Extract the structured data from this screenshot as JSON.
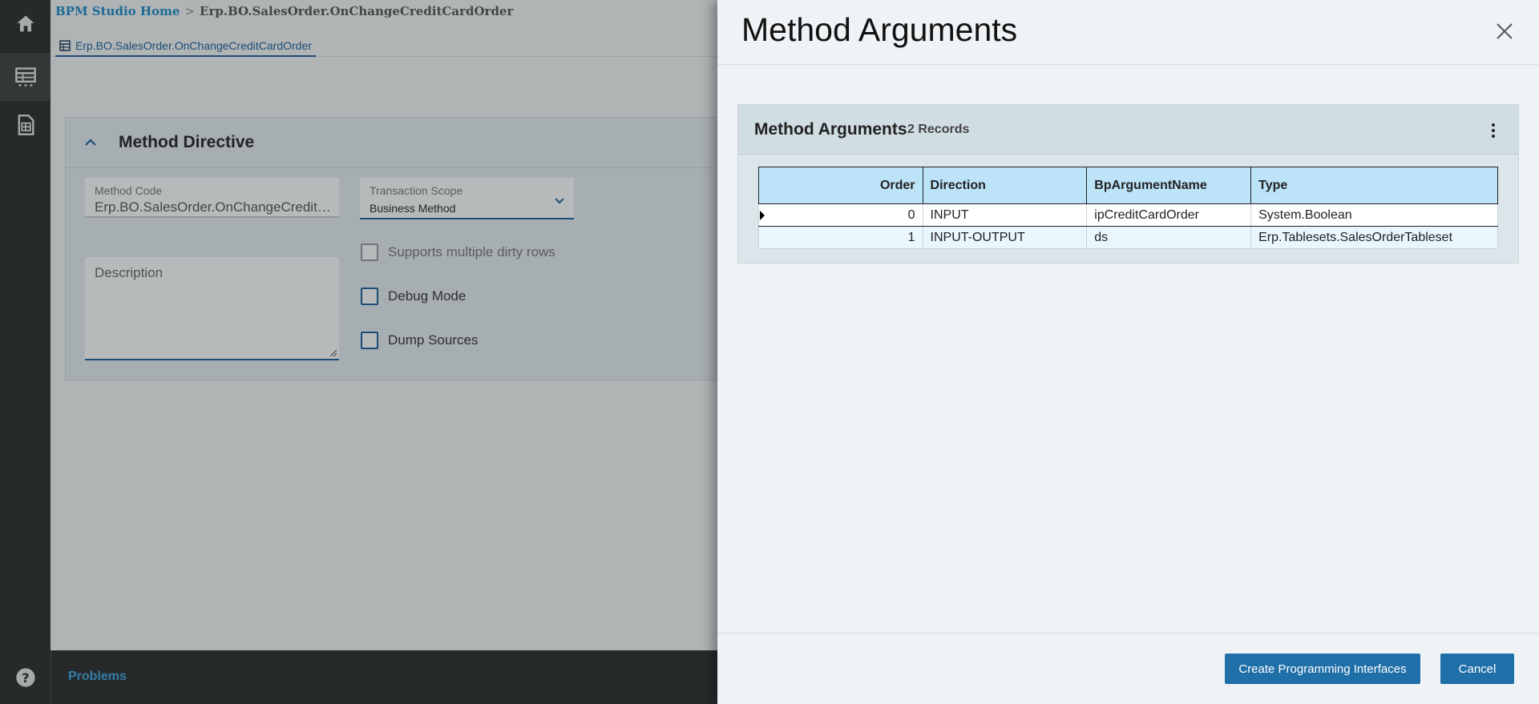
{
  "breadcrumb": {
    "home": "BPM Studio Home",
    "separator": ">",
    "current": "Erp.BO.SalesOrder.OnChangeCreditCardOrder"
  },
  "doc_tab": {
    "label": "Erp.BO.SalesOrder.OnChangeCreditCardOrder",
    "icon": "grid-icon"
  },
  "nav": {
    "items": [
      {
        "icon": "home-icon"
      },
      {
        "icon": "table-icon"
      },
      {
        "icon": "report-icon"
      }
    ],
    "help_icon": "help-icon"
  },
  "method_directive": {
    "title": "Method Directive",
    "method_code": {
      "label": "Method Code",
      "value": "Erp.BO.SalesOrder.OnChangeCreditCar…"
    },
    "transaction_scope": {
      "label": "Transaction Scope",
      "value": "Business Method"
    },
    "description": {
      "label": "Description"
    },
    "checkboxes": {
      "multiple_dirty_rows": {
        "label": "Supports multiple dirty rows",
        "checked": false
      },
      "debug_mode": {
        "label": "Debug Mode",
        "checked": false
      },
      "dump_sources": {
        "label": "Dump Sources",
        "checked": false
      }
    }
  },
  "problems": {
    "label": "Problems"
  },
  "dialog": {
    "title": "Method Arguments",
    "grid": {
      "title": "Method Arguments",
      "record_count": "2 Records",
      "columns": [
        "Order",
        "Direction",
        "BpArgumentName",
        "Type"
      ],
      "rows": [
        [
          "0",
          "INPUT",
          "ipCreditCardOrder",
          "System.Boolean"
        ],
        [
          "1",
          "INPUT-OUTPUT",
          "ds",
          "Erp.Tablesets.SalesOrderTableset"
        ]
      ]
    },
    "buttons": {
      "create": "Create Programming Interfaces",
      "cancel": "Cancel"
    }
  },
  "colors": {
    "accent": "#1f6fa8",
    "link": "#1a89c9",
    "header_cell": "#bde3f8",
    "rail": "#2b2b2b"
  }
}
